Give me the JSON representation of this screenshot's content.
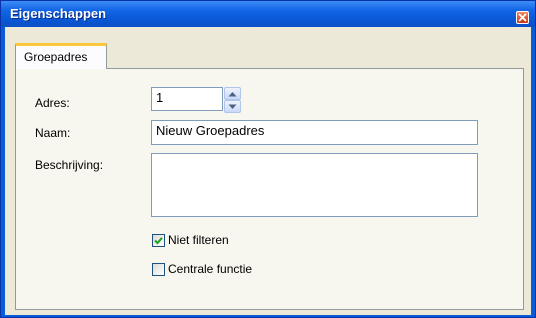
{
  "window": {
    "title": "Eigenschappen",
    "close_icon": "close-icon"
  },
  "tabs": [
    {
      "label": "Groepadres",
      "selected": true
    }
  ],
  "form": {
    "adres": {
      "label": "Adres:",
      "value": "1",
      "spin_icons": [
        "spin-up-icon",
        "spin-down-icon"
      ]
    },
    "naam": {
      "label": "Naam:",
      "value": "Nieuw Groepadres"
    },
    "beschrijving": {
      "label": "Beschrijving:",
      "value": ""
    },
    "niet_filteren": {
      "label": "Niet filteren",
      "checked": true
    },
    "centrale_functie": {
      "label": "Centrale functie",
      "checked": false
    }
  },
  "colors": {
    "titlebar": "#0a58d6",
    "client": "#ece9d8",
    "tab_highlight": "#ffc83c",
    "checkmark": "#21a121"
  }
}
